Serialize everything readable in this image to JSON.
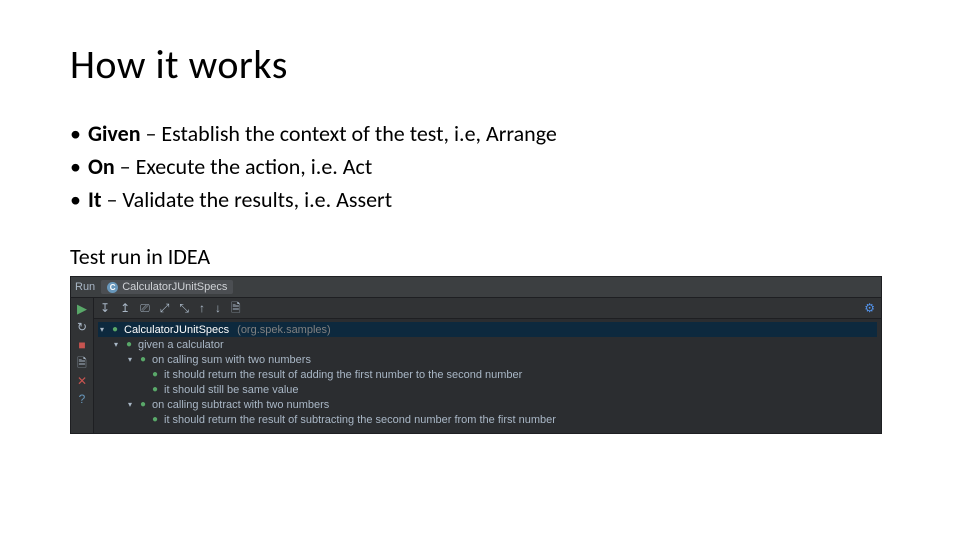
{
  "title": "How it works",
  "bullets": [
    {
      "term": "Given",
      "rest": " – Establish the context of the test, i.e, Arrange"
    },
    {
      "term": "On",
      "rest": " – Execute the action, i.e. Act"
    },
    {
      "term": "It",
      "rest": " – Validate the results, i.e. Assert"
    }
  ],
  "subhead": "Test run in IDEA",
  "ide": {
    "run_label": "Run",
    "tab_name": "CalculatorJUnitSpecs",
    "icons": {
      "run": "▶",
      "rerun": "↻",
      "stop": "■",
      "x": "✕",
      "help": "?",
      "sort_down": "↧",
      "sort_up": "↥",
      "filter": "⎚",
      "expand": "⤢",
      "collapse": "⤡",
      "prev": "↑",
      "next": "↓",
      "export": "🗎",
      "gear": "⚙",
      "class_badge": "C",
      "triangle": "▾",
      "ok": "●"
    },
    "tree": {
      "root": {
        "name": "CalculatorJUnitSpecs",
        "pkg": "(org.spek.samples)"
      },
      "groups": [
        {
          "label": "given a calculator",
          "children": [
            {
              "label": "on calling sum with two numbers",
              "children": [
                {
                  "label": "it should return the result of adding the first number to the second number"
                },
                {
                  "label": "it should still be same value"
                }
              ]
            },
            {
              "label": "on calling subtract with two numbers",
              "children": [
                {
                  "label": "it should return the result of subtracting the second number from the first number"
                }
              ]
            }
          ]
        }
      ]
    }
  }
}
